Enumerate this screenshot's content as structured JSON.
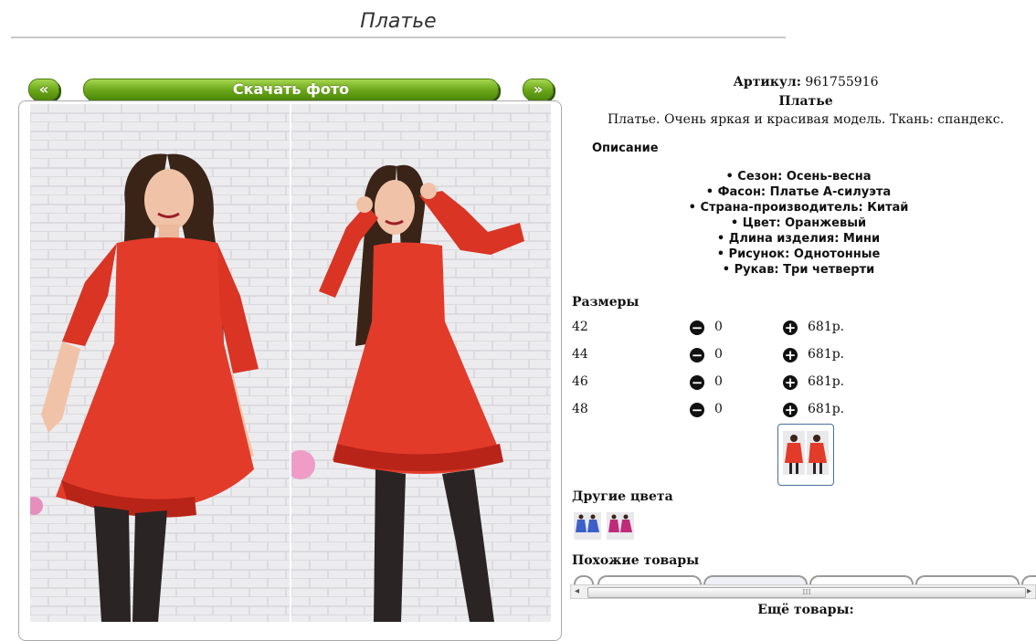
{
  "page": {
    "title": "Платье"
  },
  "gallery": {
    "prev_label": "«",
    "download_label": "Скачать фото",
    "next_label": "»"
  },
  "product": {
    "article_label": "Артикул:",
    "article_value": "961755916",
    "name": "Платье",
    "short_description": "Платье. Очень яркая и красивая модель. Ткань: спандекс.",
    "description_heading": "Описание",
    "features": [
      "Сезон: Осень-весна",
      "Фасон: Платье А-силуэта",
      "Страна-производитель: Китай",
      "Цвет: Оранжевый",
      "Длина изделия: Мини",
      "Рисунок: Однотонные",
      "Рукав: Три четверти"
    ]
  },
  "sizes": {
    "heading": "Размеры",
    "rows": [
      {
        "size": "42",
        "qty": "0",
        "price": "681р."
      },
      {
        "size": "44",
        "qty": "0",
        "price": "681р."
      },
      {
        "size": "46",
        "qty": "0",
        "price": "681р."
      },
      {
        "size": "48",
        "qty": "0",
        "price": "681р."
      }
    ]
  },
  "other_colors": {
    "heading": "Другие цвета"
  },
  "similar": {
    "heading": "Похожие товары",
    "scroll_grip": "III"
  },
  "more": {
    "heading": "Ещё товары:"
  },
  "colors": {
    "dress_red": "#e23b2a",
    "button_green": "#6aa519",
    "swatch_blue": "#3d5fc8",
    "swatch_pink": "#c02a7a",
    "wall": "#e9e9ec"
  },
  "icons": {
    "minus": "minus-circle-icon",
    "plus": "plus-circle-icon"
  }
}
